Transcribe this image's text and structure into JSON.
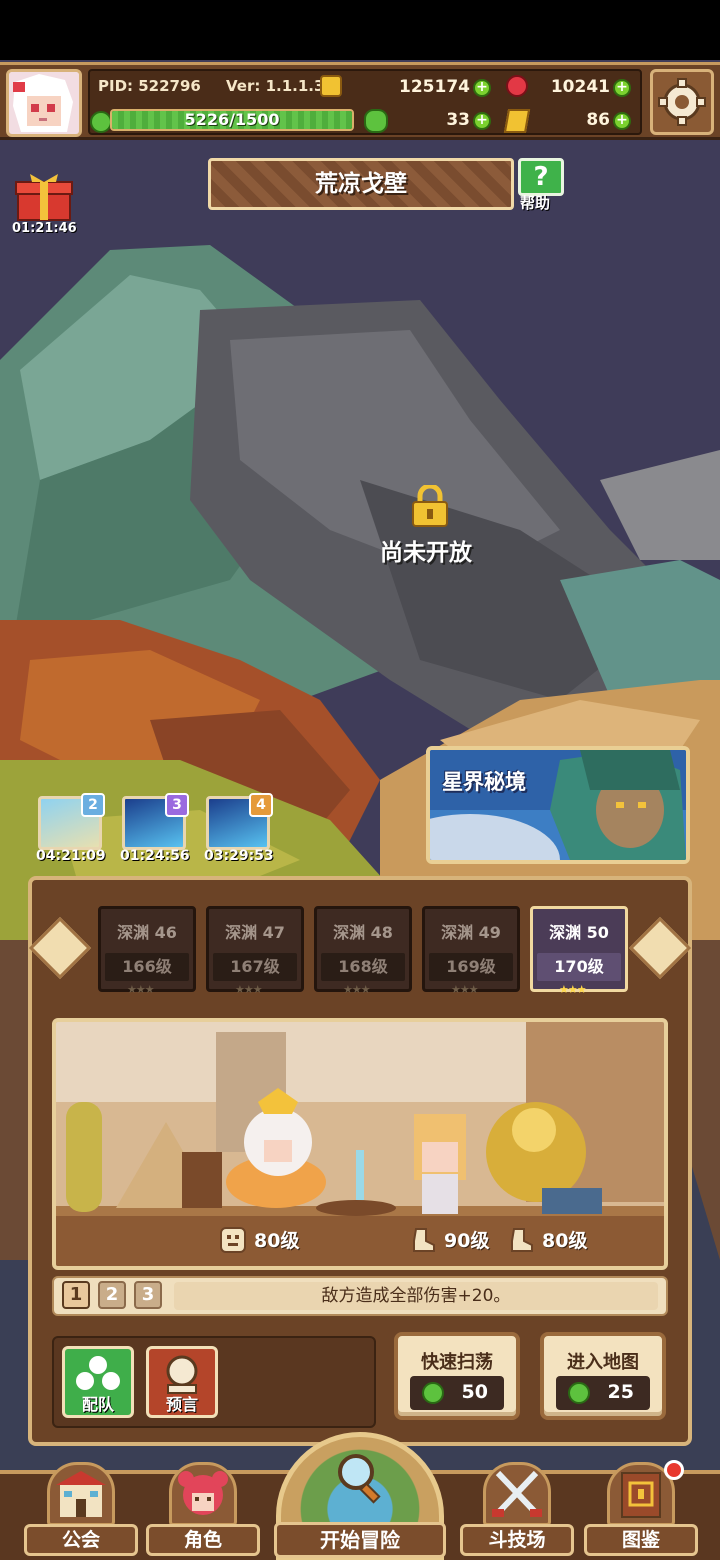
{
  "player": {
    "pid_label": "PID: 522796",
    "version_label": "Ver: 1.1.1.3",
    "exp_current": 5226,
    "exp_max": 1500,
    "exp_text": "5226/1500",
    "exp_fill_fraction": 1.0
  },
  "resources": {
    "gold": "125174",
    "gems": "10241",
    "clovers": "33",
    "keys": "86"
  },
  "area": {
    "title": "荒凉戈壁",
    "help_label": "帮助",
    "locked_text": "尚未开放"
  },
  "gift": {
    "timer": "01:21:46"
  },
  "portals": [
    {
      "number": "2",
      "timer": "04:21:09",
      "color": "#6aaee0"
    },
    {
      "number": "3",
      "timer": "01:24:56",
      "color": "#9a6adf"
    },
    {
      "number": "4",
      "timer": "03:29:53",
      "color": "#e59a3a"
    }
  ],
  "astral_banner": {
    "label": "星界秘境"
  },
  "stages": [
    {
      "name": "深渊 46",
      "level": "166级",
      "active": false
    },
    {
      "name": "深渊 47",
      "level": "167级",
      "active": false
    },
    {
      "name": "深渊 48",
      "level": "168级",
      "active": false
    },
    {
      "name": "深渊 49",
      "level": "169级",
      "active": false
    },
    {
      "name": "深渊 50",
      "level": "170级",
      "active": true
    }
  ],
  "battle": {
    "enemy_level": "80级",
    "ally_level_1": "90级",
    "ally_level_2": "80级"
  },
  "effect": {
    "pages": [
      "1",
      "2",
      "3"
    ],
    "current_page": 1,
    "text": "敌方造成全部伤害+20。"
  },
  "buttons": {
    "team": "配队",
    "prophecy": "预言",
    "sweep": "快速扫荡",
    "sweep_cost": "50",
    "enter_map": "进入地图",
    "enter_cost": "25"
  },
  "nav": {
    "guild": "公会",
    "character": "角色",
    "adventure": "开始冒险",
    "arena": "斗技场",
    "codex": "图鉴"
  },
  "colors": {
    "panel_brown": "#6b4326",
    "frame_tan": "#d7b47b",
    "exp_green": "#62c34a",
    "active_stage": "#4b3c57"
  }
}
